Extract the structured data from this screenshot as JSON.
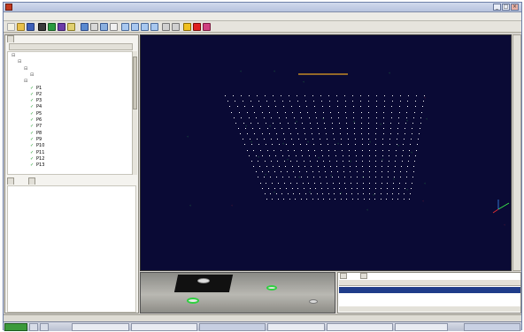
{
  "window": {
    "title": "",
    "min_label": "_",
    "max_label": "□",
    "close_label": "×"
  },
  "menu": [
    "",
    "",
    "",
    "",
    "",
    "",
    ""
  ],
  "left_panel": {
    "tab_label": "",
    "col_headers": [
      "",
      ""
    ],
    "tree": [
      {
        "indent": 1,
        "name": "",
        "value": "",
        "check": false
      },
      {
        "indent": 2,
        "name": "",
        "value": "",
        "check": false
      },
      {
        "indent": 3,
        "name": "",
        "value": "",
        "check": false
      },
      {
        "indent": 4,
        "name": "",
        "value": "",
        "check": false
      },
      {
        "indent": 3,
        "name": "",
        "value": "",
        "check": false
      },
      {
        "indent": 4,
        "name": "P1",
        "value": "",
        "check": true
      },
      {
        "indent": 4,
        "name": "P2",
        "value": "",
        "check": true
      },
      {
        "indent": 4,
        "name": "P3",
        "value": "",
        "check": true
      },
      {
        "indent": 4,
        "name": "P4",
        "value": "",
        "check": true
      },
      {
        "indent": 4,
        "name": "P5",
        "value": "",
        "check": true
      },
      {
        "indent": 4,
        "name": "P6",
        "value": "",
        "check": true
      },
      {
        "indent": 4,
        "name": "P7",
        "value": "",
        "check": true
      },
      {
        "indent": 4,
        "name": "P8",
        "value": "",
        "check": true
      },
      {
        "indent": 4,
        "name": "P9",
        "value": "",
        "check": true
      },
      {
        "indent": 4,
        "name": "P10",
        "value": "",
        "check": true
      },
      {
        "indent": 4,
        "name": "P11",
        "value": "",
        "check": true
      },
      {
        "indent": 4,
        "name": "P12",
        "value": "",
        "check": true
      },
      {
        "indent": 4,
        "name": "P13",
        "value": "",
        "check": true
      }
    ],
    "props_tabs": [
      "",
      ""
    ],
    "props_lines": [
      "",
      "",
      "",
      "",
      "",
      "",
      "",
      "",
      ""
    ]
  },
  "viewport": {
    "green_labels": [],
    "red_labels": [],
    "axis_labels": {
      "x": "",
      "y": "",
      "z": ""
    }
  },
  "image_pane": {
    "title": ""
  },
  "table": {
    "tabs": [
      "",
      ""
    ],
    "headers": [
      "",
      "",
      "",
      "",
      "",
      "",
      ""
    ],
    "rows": [
      [
        "",
        "",
        "",
        "",
        "",
        "",
        ""
      ],
      [
        "",
        "",
        "",
        "",
        "",
        "",
        ""
      ],
      [
        "",
        "",
        "",
        "",
        "",
        "",
        ""
      ]
    ]
  },
  "status": {
    "left": "",
    "right": ""
  },
  "taskbar": {
    "start_label": "",
    "tasks": [
      "",
      "",
      "",
      "",
      "",
      ""
    ],
    "clock": ""
  }
}
